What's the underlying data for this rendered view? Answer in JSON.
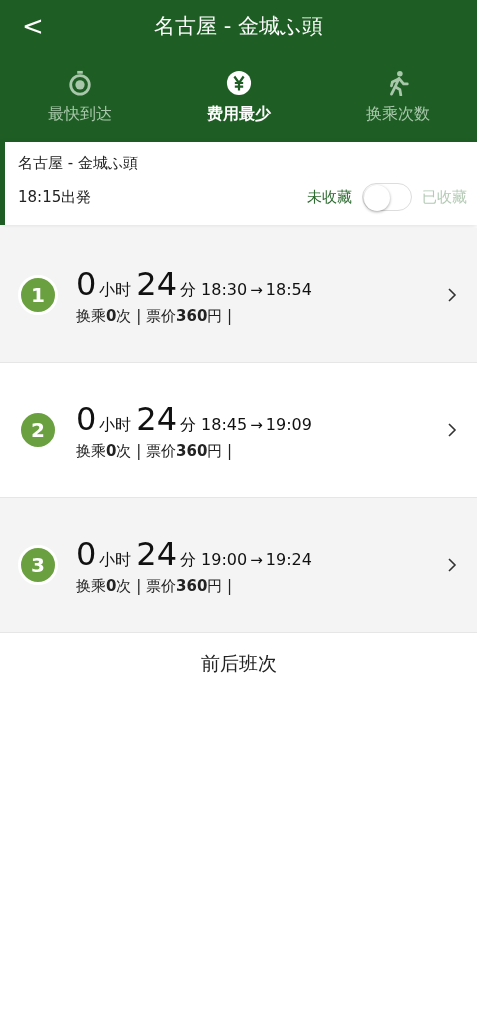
{
  "header": {
    "back": "<",
    "title": "名古屋 - 金城ふ頭"
  },
  "tabs": [
    {
      "label": "最快到达",
      "kind": "fastest",
      "selected": false
    },
    {
      "label": "费用最少",
      "kind": "cheapest",
      "selected": true
    },
    {
      "label": "换乘次数",
      "kind": "transfers",
      "selected": false
    }
  ],
  "trip": {
    "route": "名古屋 - 金城ふ頭",
    "departure": "18:15出発",
    "favorite": {
      "off_label": "未收藏",
      "on_label": "已收藏",
      "on": false
    }
  },
  "routes": [
    {
      "number": "1",
      "hours": "0",
      "hours_unit": "小时",
      "minutes": "24",
      "minutes_unit": "分",
      "depart": "18:30",
      "arrow": "→",
      "arrive": "18:54",
      "summary": "换乘**0**次 | 票价**360**円 |"
    },
    {
      "number": "2",
      "hours": "0",
      "hours_unit": "小时",
      "minutes": "24",
      "minutes_unit": "分",
      "depart": "18:45",
      "arrow": "→",
      "arrive": "19:09",
      "summary": "换乘**0**次 | 票价**360**円 |"
    },
    {
      "number": "3",
      "hours": "0",
      "hours_unit": "小时",
      "minutes": "24",
      "minutes_unit": "分",
      "depart": "19:00",
      "arrow": "→",
      "arrive": "19:24",
      "summary": "换乘**0**次 | 票价**360**円 |"
    }
  ],
  "more_button": "前后班次"
}
